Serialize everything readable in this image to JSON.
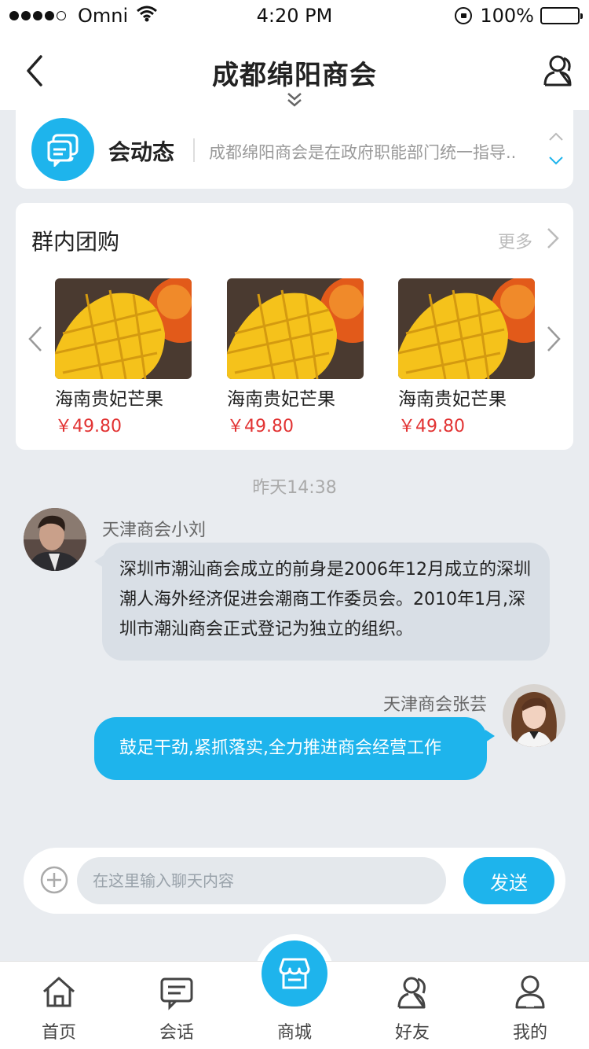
{
  "status_bar": {
    "carrier": "Omni",
    "time": "4:20 PM",
    "battery": "100%"
  },
  "header": {
    "title": "成都绵阳商会"
  },
  "news": {
    "label": "会动态",
    "text": "成都绵阳商会是在政府职能部门统一指导.."
  },
  "group_buy": {
    "title": "群内团购",
    "more_label": "更多",
    "products": [
      {
        "name": "海南贵妃芒果",
        "price": "￥49.80"
      },
      {
        "name": "海南贵妃芒果",
        "price": "￥49.80"
      },
      {
        "name": "海南贵妃芒果",
        "price": "￥49.80"
      }
    ]
  },
  "chat": {
    "timestamp": "昨天14:38",
    "messages": [
      {
        "sender": "天津商会小刘",
        "text": "深圳市潮汕商会成立的前身是2006年12月成立的深圳潮人海外经济促进会潮商工作委员会。2010年1月,深圳市潮汕商会正式登记为独立的组织。",
        "side": "left"
      },
      {
        "sender": "天津商会张芸",
        "text": "鼓足干劲,紧抓落实,全力推进商会经营工作",
        "side": "right"
      }
    ]
  },
  "input": {
    "placeholder": "在这里输入聊天内容",
    "value": "",
    "send_label": "发送"
  },
  "tabbar": {
    "items": [
      {
        "label": "首页",
        "icon": "home-icon"
      },
      {
        "label": "会话",
        "icon": "chat-icon"
      },
      {
        "label": "商城",
        "icon": "store-icon"
      },
      {
        "label": "好友",
        "icon": "friends-icon"
      },
      {
        "label": "我的",
        "icon": "profile-icon"
      }
    ]
  },
  "colors": {
    "accent": "#1eb4ec",
    "price": "#e23333",
    "background": "#e9ecf0"
  }
}
